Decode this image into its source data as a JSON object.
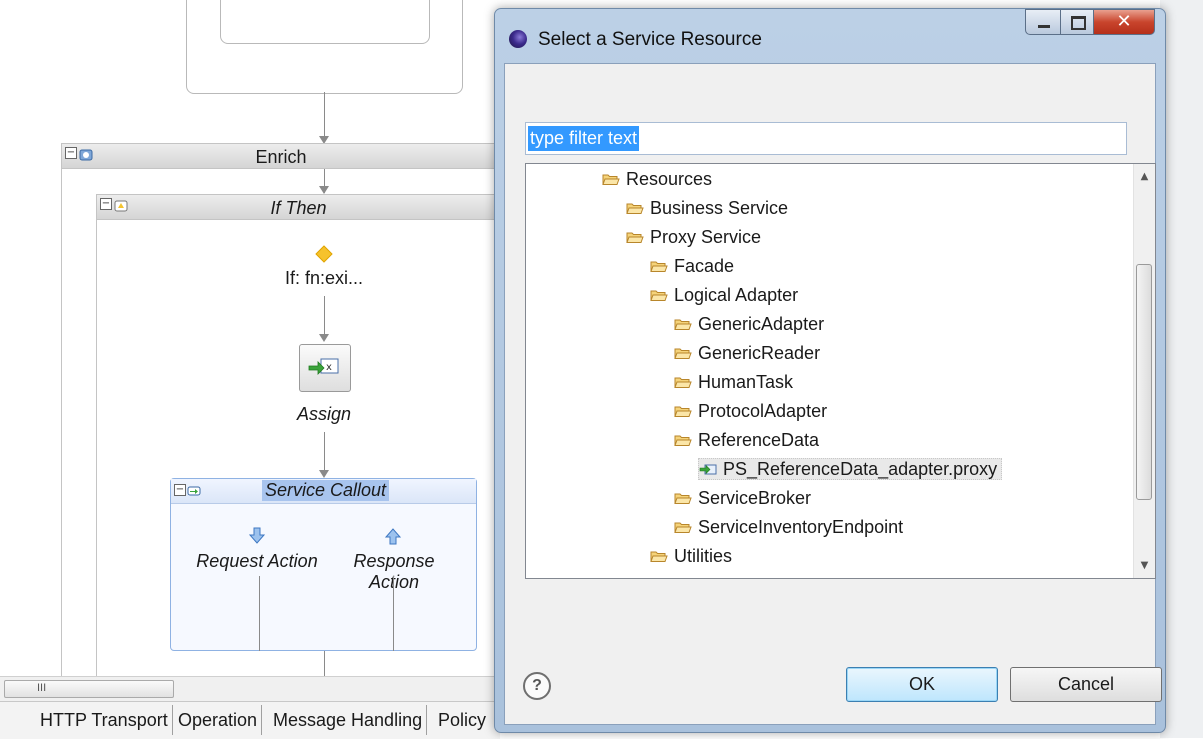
{
  "background": {
    "stages": [
      {
        "id": "enrich",
        "title": "Enrich"
      },
      {
        "id": "if_then",
        "title": "If Then"
      }
    ],
    "condition_label": "If: fn:exi...",
    "assign_label": "Assign",
    "service_callout": {
      "title": "Service Callout",
      "request_label": "Request Action",
      "response_label": "Response Action"
    },
    "scroll_thumb_label": "III",
    "bottom_tabs": [
      "HTTP Transport",
      "Operation",
      "Message Handling",
      "Policy"
    ]
  },
  "dialog": {
    "title": "Select a Service Resource",
    "close_glyph": "✕",
    "filter": {
      "value": "type filter text"
    },
    "tree": [
      {
        "label": "Resources",
        "level": 0,
        "type": "folder"
      },
      {
        "label": "Business Service",
        "level": 1,
        "type": "folder"
      },
      {
        "label": "Proxy Service",
        "level": 1,
        "type": "folder"
      },
      {
        "label": "Facade",
        "level": 2,
        "type": "folder"
      },
      {
        "label": "Logical Adapter",
        "level": 2,
        "type": "folder"
      },
      {
        "label": "GenericAdapter",
        "level": 3,
        "type": "folder"
      },
      {
        "label": "GenericReader",
        "level": 3,
        "type": "folder"
      },
      {
        "label": "HumanTask",
        "level": 3,
        "type": "folder"
      },
      {
        "label": "ProtocolAdapter",
        "level": 3,
        "type": "folder"
      },
      {
        "label": "ReferenceData",
        "level": 3,
        "type": "folder"
      },
      {
        "label": "PS_ReferenceData_adapter.proxy",
        "level": 4,
        "type": "proxy",
        "selected": true
      },
      {
        "label": "ServiceBroker",
        "level": 3,
        "type": "folder"
      },
      {
        "label": "ServiceInventoryEndpoint",
        "level": 3,
        "type": "folder"
      },
      {
        "label": "Utilities",
        "level": 2,
        "type": "folder"
      }
    ],
    "help_glyph": "?",
    "ok_label": "OK",
    "cancel_label": "Cancel"
  },
  "colors": {
    "selection_blue": "#3399ff",
    "folder_fill": "#f5d37a",
    "folder_stroke": "#b8862b",
    "callout_highlight": "#a8c4ee"
  }
}
